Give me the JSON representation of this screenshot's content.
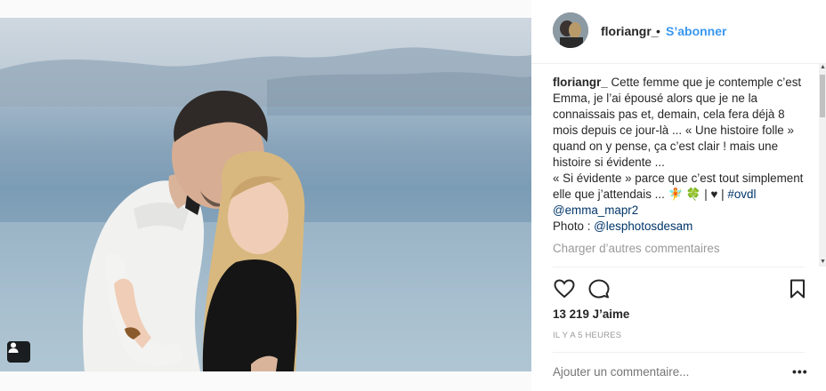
{
  "post": {
    "username": "floriangr_",
    "separator": "•",
    "follow_label": "S’abonner",
    "caption": {
      "author": "floriangr_",
      "text_1": "Cette femme que je contemple c’est Emma, je l’ai épousé alors que je ne la connaissais pas et, demain, cela fera déjà 8 mois depuis ce jour-là ... « Une histoire folle » quand on y pense, ça c’est clair ! mais une histoire si évidente ...",
      "text_2": "« Si évidente » parce que c’est tout simplement elle que j’attendais ... 🧚 🍀 | ♥ |",
      "hashtag": "#ovdl",
      "mention_1": "@emma_mapr2",
      "photo_prefix": "Photo :",
      "mention_2": "@lesphotosdesam"
    },
    "load_more_label": "Charger d’autres commentaires",
    "likes_label": "13 219 J’aime",
    "timestamp": "IL Y A 5 HEURES",
    "add_comment_placeholder": "Ajouter un commentaire...",
    "more_options": "•••"
  },
  "icons": {
    "like": "heart-outline-icon",
    "comment": "comment-bubble-icon",
    "save": "bookmark-icon",
    "user_tag": "user-tag-icon"
  },
  "colors": {
    "link_blue": "#3897f0",
    "text": "#262626",
    "muted": "#999999",
    "hashtag": "#003569"
  }
}
